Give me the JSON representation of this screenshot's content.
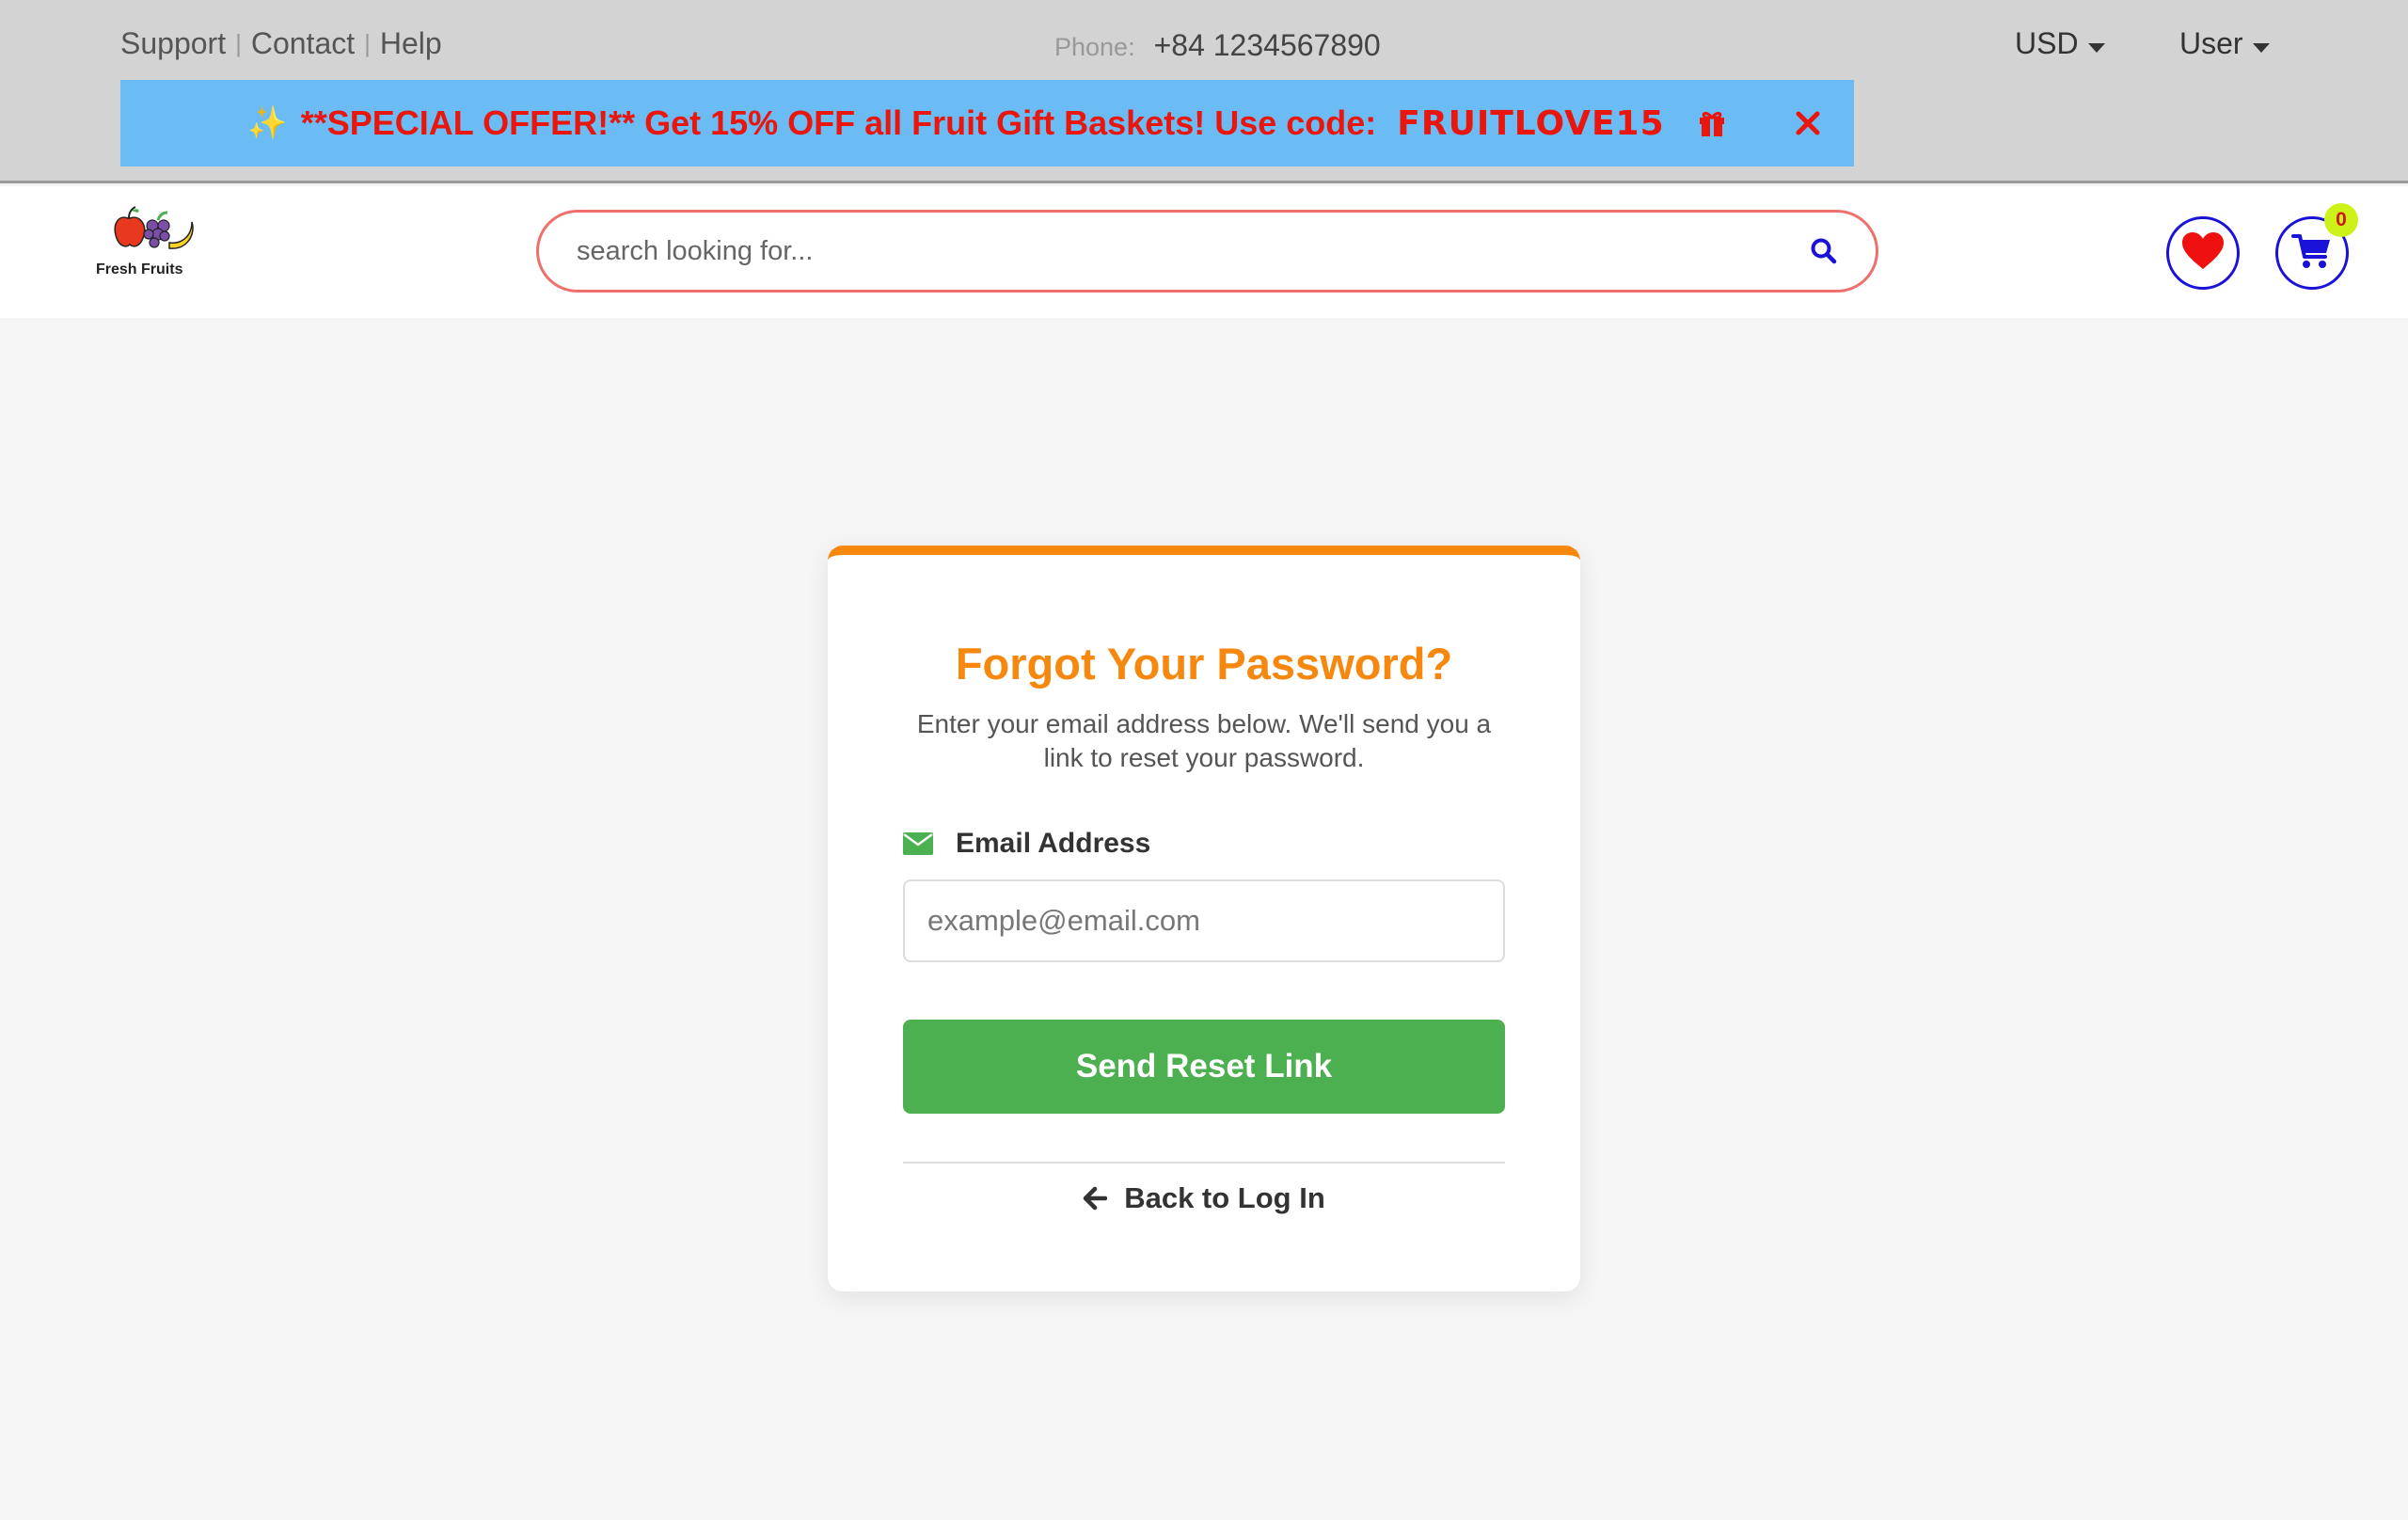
{
  "topbar": {
    "links": [
      "Support",
      "Contact",
      "Help"
    ],
    "separator": "|",
    "phone_label": "Phone:",
    "phone_number": "+84 1234567890",
    "currency": "USD",
    "user": "User"
  },
  "promo": {
    "sparkle": "✨",
    "text": "**SPECIAL OFFER!** Get 15% OFF all Fruit Gift Baskets! Use code:",
    "code": "FRUITLOVE15",
    "gift_icon": "gift-icon",
    "close_icon": "close-icon"
  },
  "header": {
    "logo_text": "Fresh Fruits",
    "search_placeholder": "search looking for...",
    "cart_count": "0"
  },
  "card": {
    "title": "Forgot Your Password?",
    "description": "Enter your email address below. We'll send you a link to reset your password.",
    "email_label": "Email Address",
    "email_placeholder": "example@email.com",
    "submit_label": "Send Reset Link",
    "back_label": "Back to Log In"
  },
  "colors": {
    "accent_orange": "#f7880f",
    "button_green": "#4caf50",
    "promo_bg": "#6bbcf4",
    "promo_text": "#e8160c",
    "icon_blue": "#1a12d6",
    "search_border": "#ef6f6c"
  }
}
